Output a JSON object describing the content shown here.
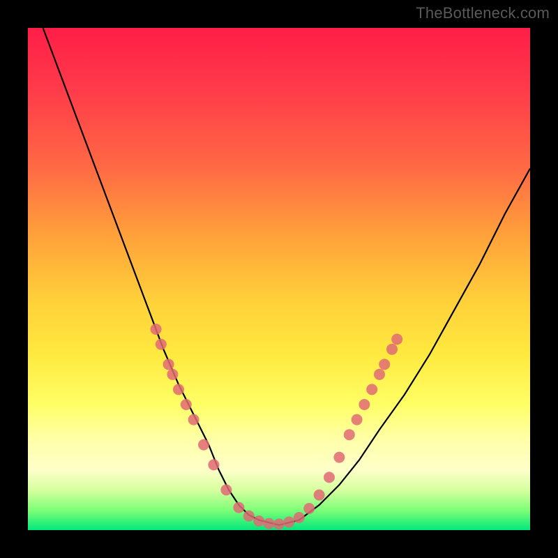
{
  "watermark": "TheBottleneck.com",
  "chart_data": {
    "type": "line",
    "title": "",
    "xlabel": "",
    "ylabel": "",
    "xlim": [
      0,
      100
    ],
    "ylim": [
      0,
      100
    ],
    "series": [
      {
        "name": "bottleneck-curve",
        "x": [
          3,
          6,
          9,
          12,
          15,
          18,
          21,
          24,
          27,
          30,
          33,
          36,
          38,
          40,
          42,
          44,
          46,
          50,
          54,
          58,
          62,
          66,
          70,
          75,
          80,
          85,
          90,
          95,
          100
        ],
        "y": [
          100,
          92,
          84,
          76,
          68,
          60,
          52,
          44,
          36,
          29,
          23,
          17,
          12,
          8,
          5,
          3,
          2,
          1,
          2,
          5,
          9,
          14,
          20,
          27,
          35,
          44,
          53,
          63,
          72
        ]
      }
    ],
    "markers": {
      "name": "highlight-dots",
      "color": "#e06a74",
      "points": [
        {
          "x": 25.5,
          "y": 40
        },
        {
          "x": 26.5,
          "y": 37
        },
        {
          "x": 28.0,
          "y": 33
        },
        {
          "x": 28.8,
          "y": 31
        },
        {
          "x": 30.0,
          "y": 28
        },
        {
          "x": 31.5,
          "y": 25
        },
        {
          "x": 33.0,
          "y": 22
        },
        {
          "x": 35.0,
          "y": 17
        },
        {
          "x": 37.0,
          "y": 13
        },
        {
          "x": 39.5,
          "y": 8
        },
        {
          "x": 42.0,
          "y": 4.5
        },
        {
          "x": 44.0,
          "y": 2.8
        },
        {
          "x": 46.0,
          "y": 1.8
        },
        {
          "x": 48.0,
          "y": 1.3
        },
        {
          "x": 50.0,
          "y": 1.2
        },
        {
          "x": 52.0,
          "y": 1.6
        },
        {
          "x": 54.0,
          "y": 2.5
        },
        {
          "x": 56.0,
          "y": 4.3
        },
        {
          "x": 58.0,
          "y": 7.0
        },
        {
          "x": 60.0,
          "y": 10.5
        },
        {
          "x": 62.0,
          "y": 14.5
        },
        {
          "x": 64.0,
          "y": 19
        },
        {
          "x": 65.5,
          "y": 22
        },
        {
          "x": 67.0,
          "y": 25
        },
        {
          "x": 68.5,
          "y": 28
        },
        {
          "x": 70.0,
          "y": 31
        },
        {
          "x": 71.0,
          "y": 33
        },
        {
          "x": 72.5,
          "y": 36
        },
        {
          "x": 73.5,
          "y": 38
        }
      ]
    }
  }
}
